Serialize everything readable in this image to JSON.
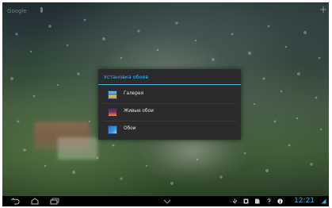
{
  "homescreen": {
    "search_label": "Google",
    "wallpaper_theme": "rain-on-glass"
  },
  "dialog": {
    "title": "Установка обоев",
    "accent_color": "#33b5e5",
    "items": [
      {
        "label": "Галерея",
        "icon": "gallery-icon"
      },
      {
        "label": "Живые обои",
        "icon": "live-wallpaper-icon"
      },
      {
        "label": "Обои",
        "icon": "wallpapers-icon"
      }
    ]
  },
  "system_bar": {
    "nav_buttons": [
      "back-icon",
      "home-icon",
      "recent-apps-icon"
    ],
    "menu_icon": "chevron-down-icon",
    "status_icons": [
      "usb-icon",
      "screenshot-icon",
      "sd-card-icon",
      "help-icon",
      "info-icon"
    ],
    "clock": "12:21",
    "clock_color": "#33b5e5"
  }
}
